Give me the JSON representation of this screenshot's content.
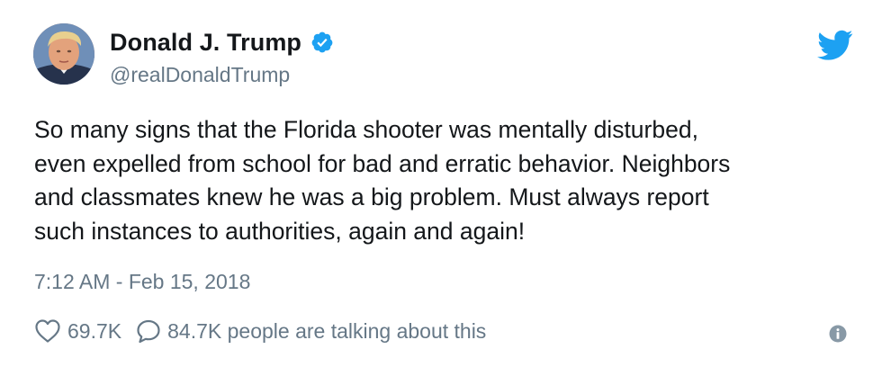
{
  "user": {
    "display_name": "Donald J. Trump",
    "handle": "@realDonaldTrump",
    "verified": true
  },
  "tweet": {
    "text": "So many signs that the Florida shooter was mentally disturbed,\neven expelled from school for bad and erratic behavior. Neighbors\nand classmates knew he was a big problem. Must always report\nsuch instances to authorities, again and again!",
    "timestamp": "7:12 AM - Feb 15, 2018"
  },
  "actions": {
    "likes": "69.7K",
    "talking": "84.7K people are talking about this"
  },
  "icons": {
    "verified": "verified-badge-icon",
    "logo": "twitter-bird-icon",
    "like": "heart-icon",
    "reply": "reply-bubble-icon",
    "info": "info-icon"
  },
  "colors": {
    "accent": "#1da1f2",
    "text": "#14171a",
    "secondary": "#657786"
  }
}
